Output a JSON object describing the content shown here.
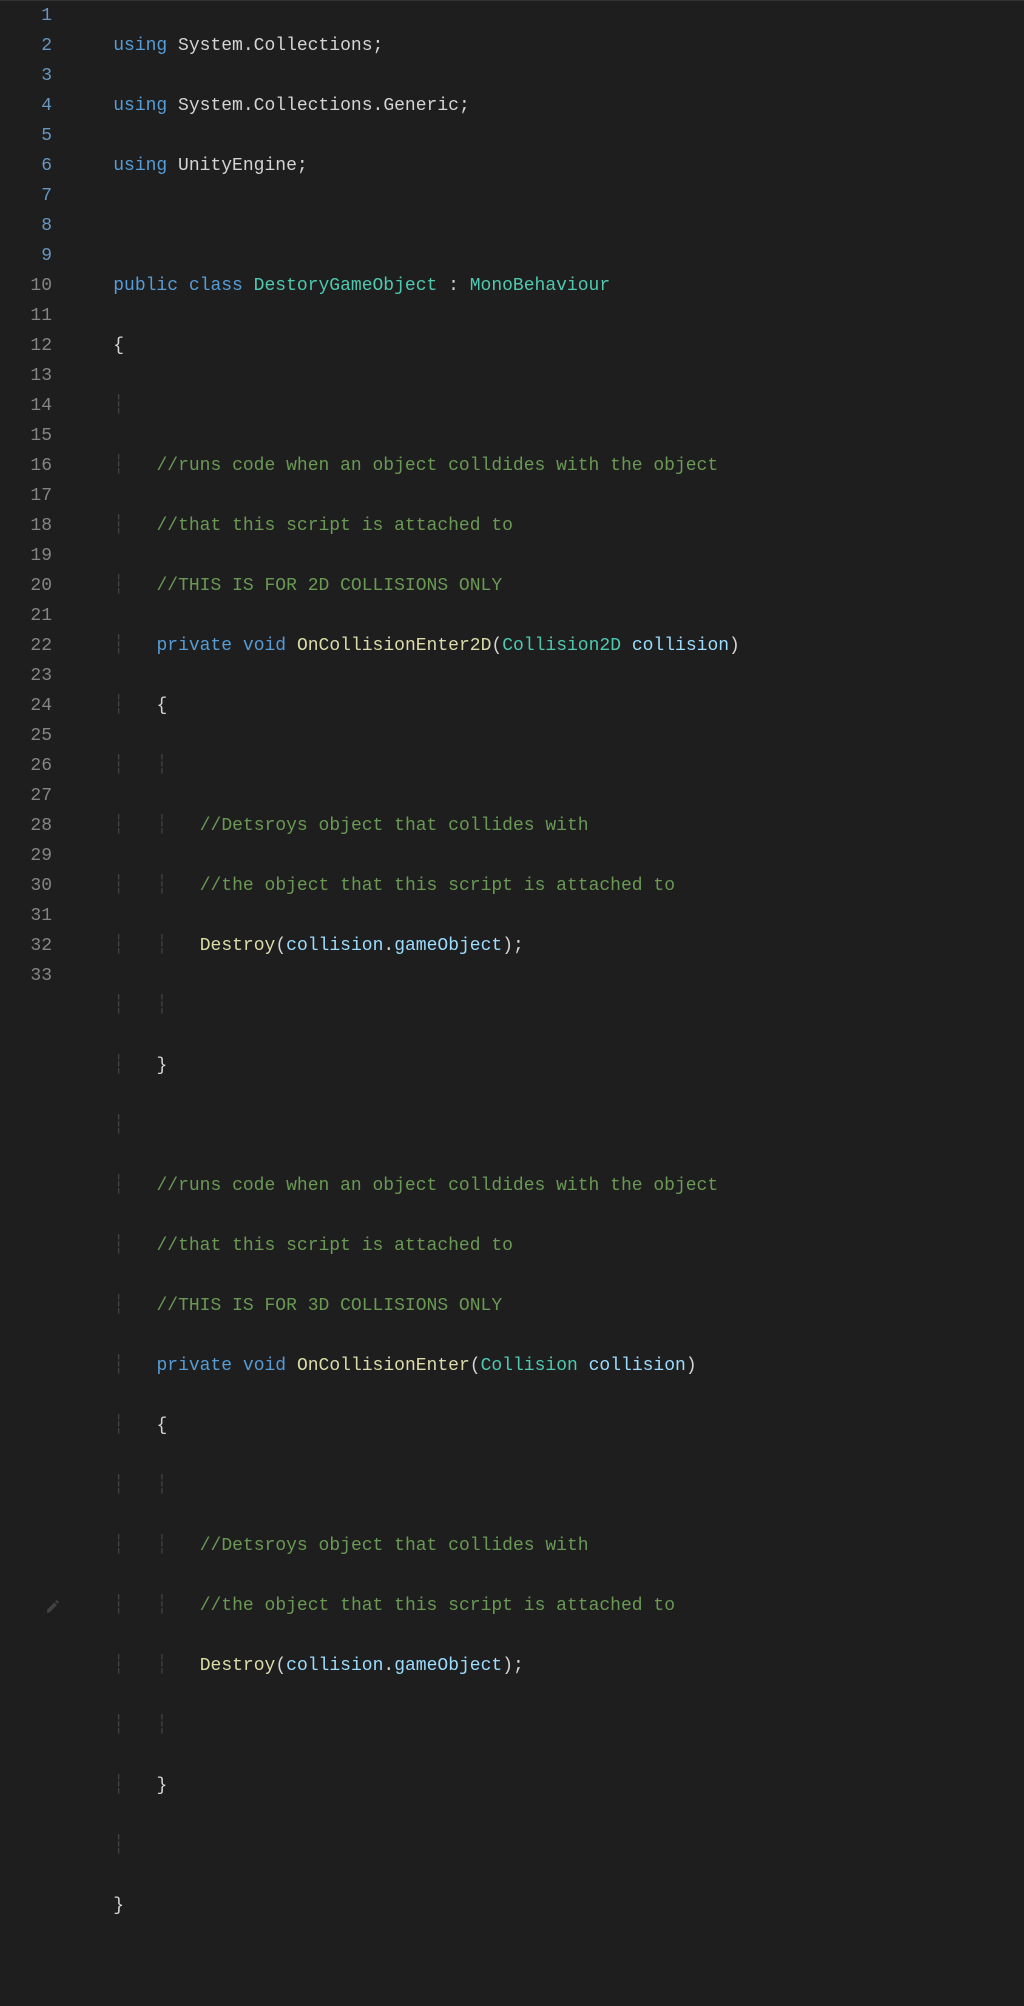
{
  "gutter": {
    "start": 1,
    "end": 33
  },
  "col": {
    "kw": "#569cd6",
    "type": "#4ec9b0",
    "fn": "#dcdcaa",
    "cm": "#6a9955",
    "id": "#9cdcfe",
    "pn": "#d4d4d4",
    "bg": "#1e1e1e",
    "gut": "#858585"
  },
  "code": {
    "l1": {
      "kw1": "using",
      "ns": "System",
      "pn1": ".",
      "m1": "Collections",
      "pn2": ";"
    },
    "l2": {
      "kw1": "using",
      "ns": "System",
      "pn1": ".",
      "m1": "Collections",
      "pn2": ".",
      "m2": "Generic",
      "pn3": ";"
    },
    "l3": {
      "kw1": "using",
      "ns": "UnityEngine",
      "pn1": ";"
    },
    "l5": {
      "kw1": "public",
      "kw2": "class",
      "cls": "DestoryGameObject",
      "pn1": " : ",
      "base": "MonoBehaviour"
    },
    "l6": {
      "b": "{"
    },
    "l8": {
      "c": "//runs code when an object colldides with the object"
    },
    "l9": {
      "c": "//that this script is attached to"
    },
    "l10": {
      "c": "//THIS IS FOR 2D COLLISIONS ONLY"
    },
    "l11": {
      "kw1": "private",
      "kw2": "void",
      "fn": "OnCollisionEnter2D",
      "p1": "(",
      "ty": "Collision2D",
      "sp": " ",
      "ar": "collision",
      "p2": ")"
    },
    "l12": {
      "b": "{"
    },
    "l14": {
      "c": "//Detsroys object that collides with"
    },
    "l15": {
      "c": "//the object that this script is attached to"
    },
    "l16": {
      "fn": "Destroy",
      "p1": "(",
      "a1": "collision",
      "pn1": ".",
      "a2": "gameObject",
      "p2": ")",
      "pn2": ";"
    },
    "l18": {
      "b": "}"
    },
    "l20": {
      "c": "//runs code when an object colldides with the object"
    },
    "l21": {
      "c": "//that this script is attached to"
    },
    "l22": {
      "c": "//THIS IS FOR 3D COLLISIONS ONLY"
    },
    "l23": {
      "kw1": "private",
      "kw2": "void",
      "fn": "OnCollisionEnter",
      "p1": "(",
      "ty": "Collision",
      "sp": " ",
      "ar": "collision",
      "p2": ")"
    },
    "l24": {
      "b": "{"
    },
    "l26": {
      "c": "//Detsroys object that collides with"
    },
    "l27": {
      "c": "//the object that this script is attached to"
    },
    "l28": {
      "fn": "Destroy",
      "p1": "(",
      "a1": "collision",
      "pn1": ".",
      "a2": "gameObject",
      "p2": ")",
      "pn2": ";"
    },
    "l30": {
      "b": "}"
    },
    "l32": {
      "b": "}"
    }
  }
}
